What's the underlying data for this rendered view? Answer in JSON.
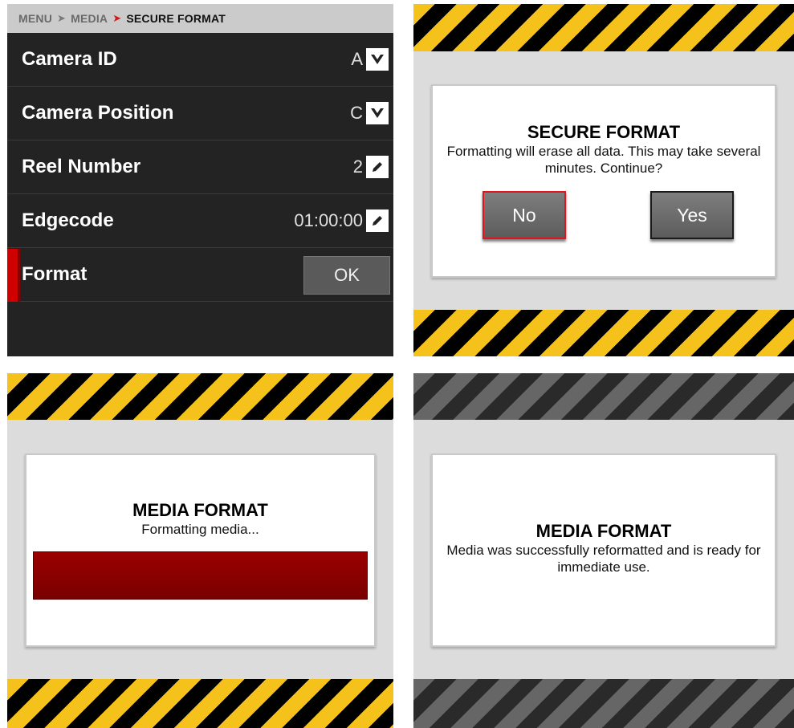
{
  "menu_screen": {
    "breadcrumb": [
      "MENU",
      "MEDIA",
      "SECURE FORMAT"
    ],
    "items": [
      {
        "label": "Camera ID",
        "value": "A",
        "icon": "chevron-down-icon"
      },
      {
        "label": "Camera Position",
        "value": "C",
        "icon": "chevron-down-icon"
      },
      {
        "label": "Reel Number",
        "value": "2",
        "icon": "pencil-icon"
      },
      {
        "label": "Edgecode",
        "value": "01:00:00",
        "icon": "pencil-icon"
      },
      {
        "label": "Format",
        "button": "OK"
      }
    ]
  },
  "confirm_dialog": {
    "title": "SECURE FORMAT",
    "message": "Formatting will erase all data. This may take several minutes. Continue?",
    "no_label": "No",
    "yes_label": "Yes"
  },
  "progress_dialog": {
    "title": "MEDIA FORMAT",
    "message": "Formatting media..."
  },
  "done_dialog": {
    "title": "MEDIA FORMAT",
    "message": "Media was successfully reformatted and is ready for immediate use."
  },
  "colors": {
    "accent_red": "#d01a1a",
    "hazard_yellow": "#f5c21b",
    "hazard_black": "#000000",
    "hazard_gray": "#666666"
  }
}
